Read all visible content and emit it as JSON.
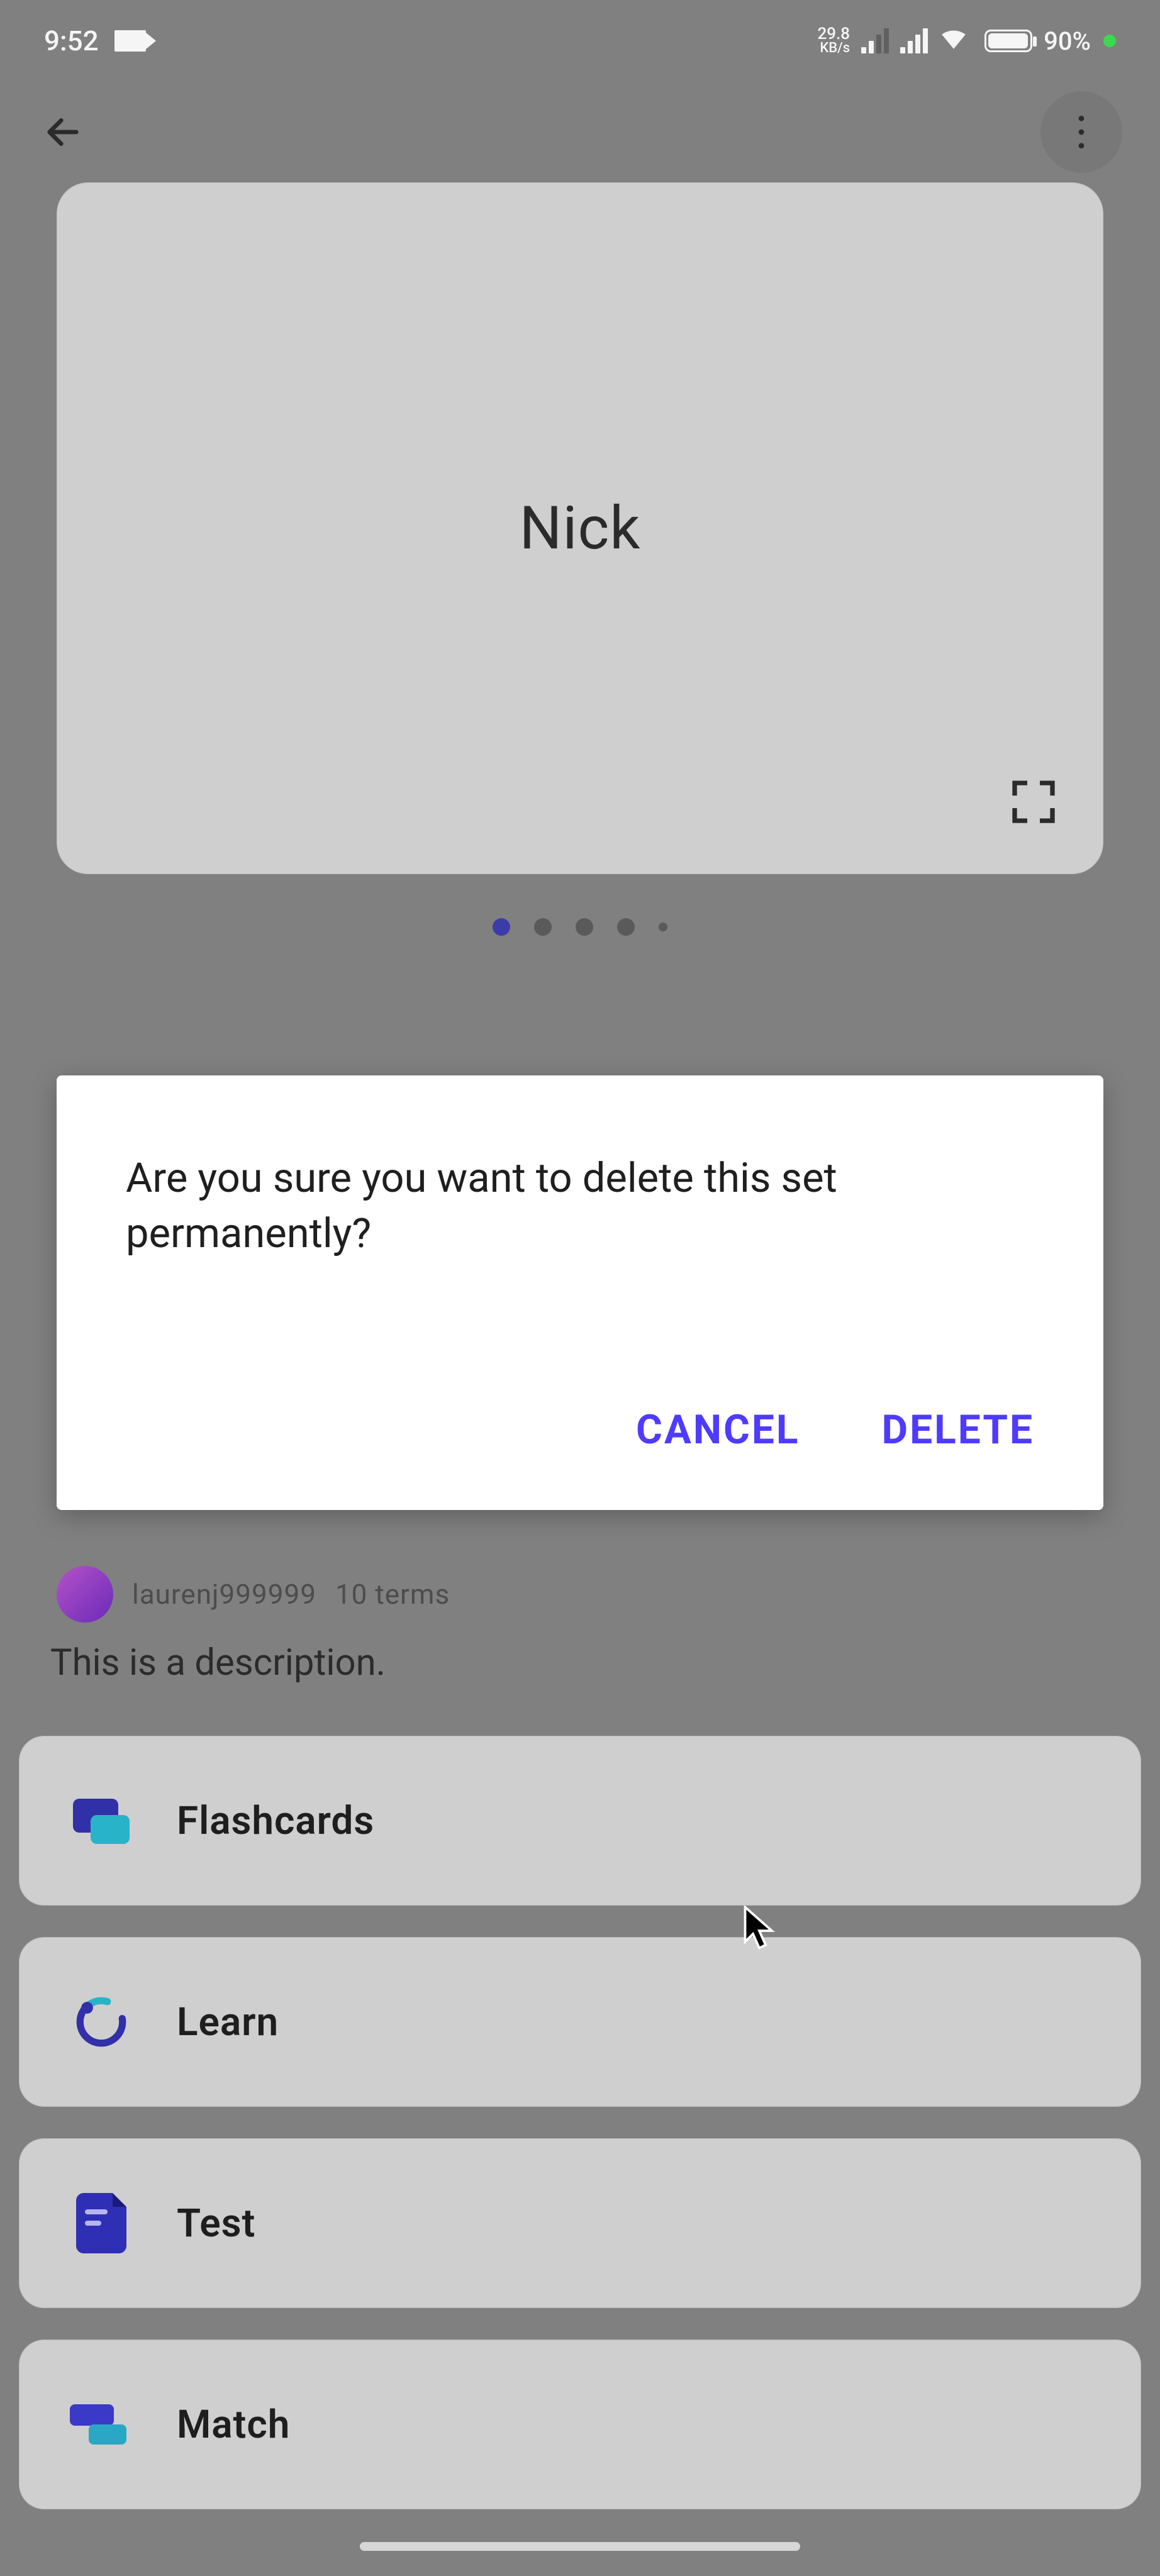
{
  "status": {
    "time": "9:52",
    "net_speed_top": "29.8",
    "net_speed_bottom": "KB/s",
    "battery_pct": "90%"
  },
  "card": {
    "title": "Nick"
  },
  "user_row": {
    "username_fragment": "laurenj999999",
    "terms_fragment": "10 terms"
  },
  "description": "This is a description.",
  "options": {
    "flashcards": "Flashcards",
    "learn": "Learn",
    "test": "Test",
    "match": "Match"
  },
  "dialog": {
    "message": "Are you sure you want to delete this set permanently?",
    "cancel": "CANCEL",
    "delete": "DELETE"
  }
}
